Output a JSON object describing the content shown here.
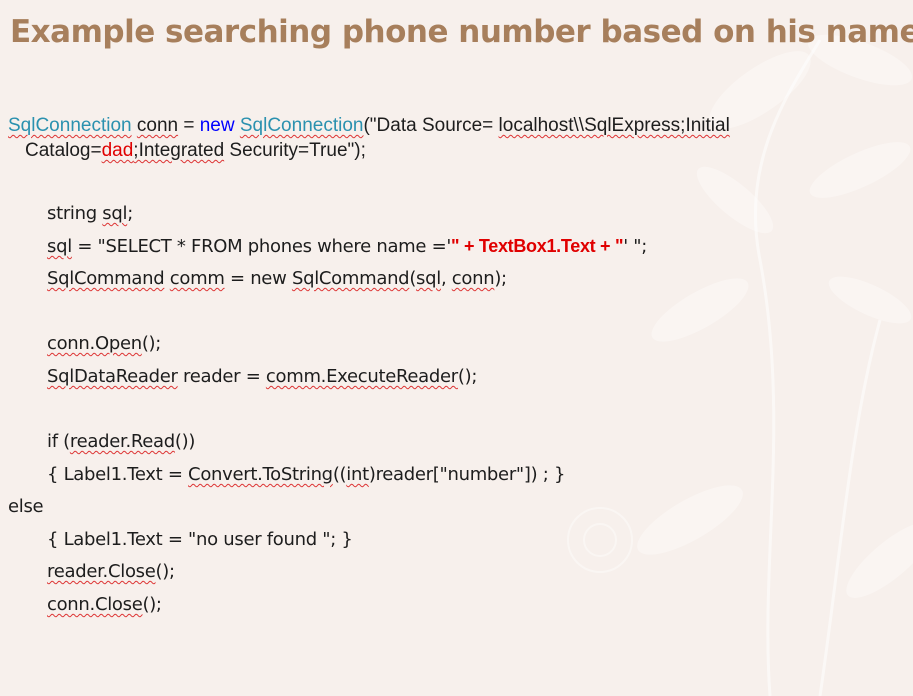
{
  "slide": {
    "title": "Example searching phone number based on his name"
  },
  "code": {
    "line1": {
      "t1": "SqlConnection",
      "t2": " ",
      "t3": "conn",
      "t4": " = ",
      "t5": "new",
      "t6": " ",
      "t7": "SqlConnection",
      "t8": "(\"Data Source= ",
      "t9": "localhost\\\\SqlExpress;Initial"
    },
    "line2": {
      "t1": "Catalog=",
      "t2": "dad",
      "t3": ";Integrated",
      "t4": " Security=True\");"
    },
    "line3": {
      "t1": "string ",
      "t2": "sql",
      "t3": ";"
    },
    "line4": {
      "t1": "sql",
      "t2": " = \"SELECT * FROM phones where name ='",
      "t3": "\" + TextBox1.Text + \"",
      "t4": "' \";"
    },
    "line5": {
      "t1": "SqlCommand",
      "t2": " ",
      "t3": "comm",
      "t4": " = new ",
      "t5": "SqlCommand",
      "t6": "(",
      "t7": "sql",
      "t8": ", ",
      "t9": "conn",
      "t10": ");"
    },
    "line6": {
      "t1": "conn.Open",
      "t2": "();"
    },
    "line7": {
      "t1": "SqlDataReader",
      "t2": " reader = ",
      "t3": "comm.ExecuteReader",
      "t4": "();"
    },
    "line8": {
      "t1": "if (",
      "t2": "reader.Read",
      "t3": "())"
    },
    "line9": {
      "t1": "{ Label1.Text = ",
      "t2": "Convert.ToString",
      "t3": "((",
      "t4": "int",
      "t5": ")reader[\"number\"]) ; }"
    },
    "line10": {
      "t1": "else"
    },
    "line11": {
      "t1": "{ Label1.Text = \"no user found \"; }"
    },
    "line12": {
      "t1": "reader.Close",
      "t2": "();"
    },
    "line13": {
      "t1": "conn.Close",
      "t2": "();"
    }
  }
}
